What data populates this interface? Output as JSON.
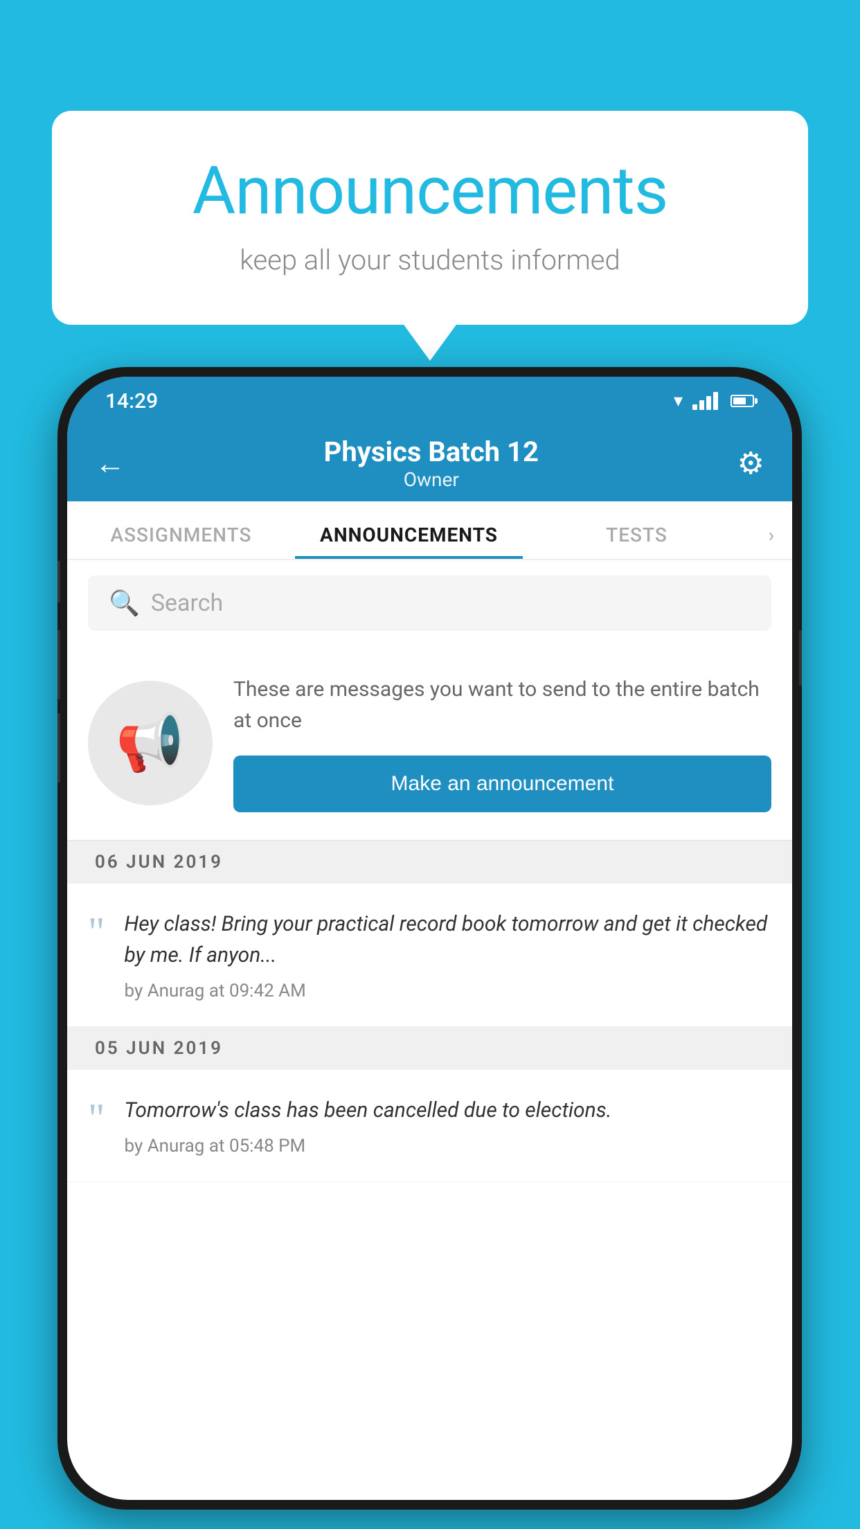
{
  "background_color": "#22bae0",
  "speech_bubble": {
    "title": "Announcements",
    "subtitle": "keep all your students informed"
  },
  "phone": {
    "status_bar": {
      "time": "14:29"
    },
    "top_bar": {
      "title": "Physics Batch 12",
      "subtitle": "Owner",
      "back_label": "←",
      "gear_label": "⚙"
    },
    "tabs": [
      {
        "label": "ASSIGNMENTS",
        "active": false
      },
      {
        "label": "ANNOUNCEMENTS",
        "active": true
      },
      {
        "label": "TESTS",
        "active": false
      }
    ],
    "search": {
      "placeholder": "Search"
    },
    "promo": {
      "description": "These are messages you want to send to the entire batch at once",
      "button_label": "Make an announcement"
    },
    "announcements": [
      {
        "date": "06  JUN  2019",
        "text": "Hey class! Bring your practical record book tomorrow and get it checked by me. If anyon...",
        "meta": "by Anurag at 09:42 AM"
      },
      {
        "date": "05  JUN  2019",
        "text": "Tomorrow's class has been cancelled due to elections.",
        "meta": "by Anurag at 05:48 PM"
      }
    ]
  }
}
